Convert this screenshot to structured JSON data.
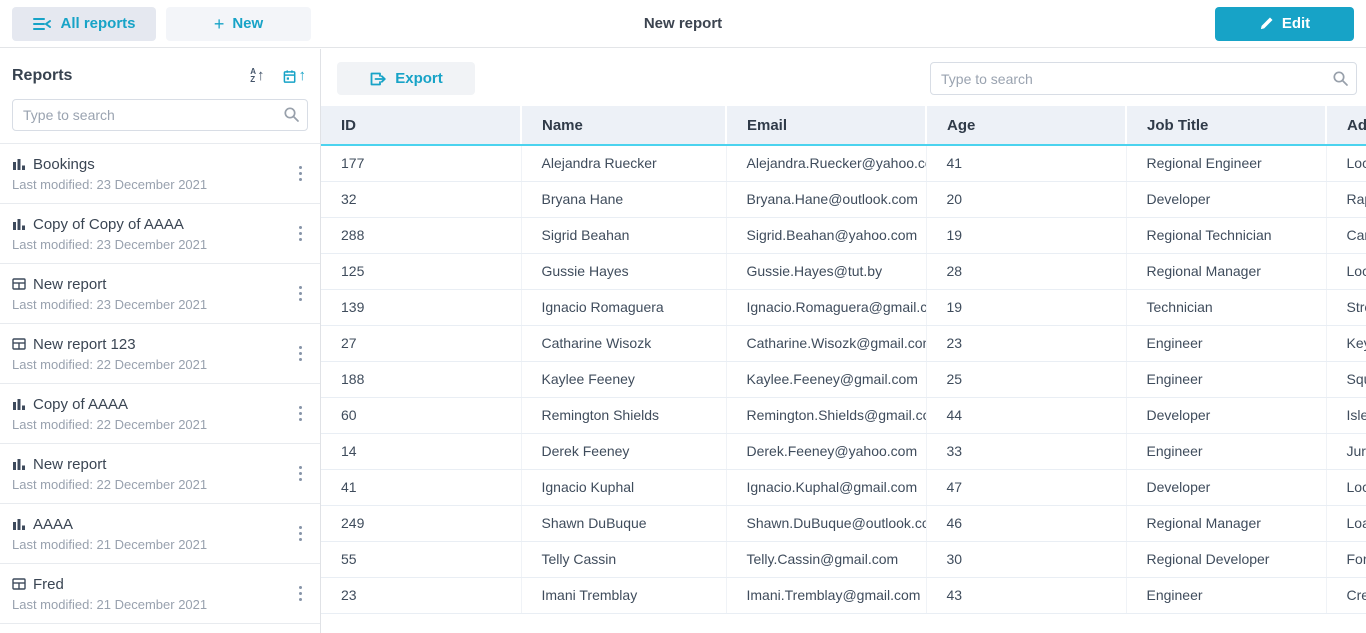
{
  "colors": {
    "accent": "#17a3c7",
    "header_underline": "#4bd3ef"
  },
  "topbar": {
    "all_reports_label": "All reports",
    "new_plus": "+",
    "new_label": "New",
    "title": "New report",
    "edit_label": "Edit"
  },
  "sidebar": {
    "header": "Reports",
    "sort_alpha_top": "A",
    "sort_alpha_bottom": "Z",
    "sort_arrow": "↑",
    "search_placeholder": "Type to search",
    "items": [
      {
        "icon": "bar-chart",
        "title": "Bookings",
        "subtitle": "Last modified: 23 December 2021"
      },
      {
        "icon": "bar-chart",
        "title": "Copy of Copy of AAAA",
        "subtitle": "Last modified: 23 December 2021"
      },
      {
        "icon": "table",
        "title": "New report",
        "subtitle": "Last modified: 23 December 2021"
      },
      {
        "icon": "table",
        "title": "New report 123",
        "subtitle": "Last modified: 22 December 2021"
      },
      {
        "icon": "bar-chart",
        "title": "Copy of AAAA",
        "subtitle": "Last modified: 22 December 2021"
      },
      {
        "icon": "bar-chart",
        "title": "New report",
        "subtitle": "Last modified: 22 December 2021"
      },
      {
        "icon": "bar-chart",
        "title": "AAAA",
        "subtitle": "Last modified: 21 December 2021"
      },
      {
        "icon": "table",
        "title": "Fred",
        "subtitle": "Last modified: 21 December 2021"
      }
    ]
  },
  "main": {
    "export_label": "Export",
    "search_placeholder": "Type to search",
    "table": {
      "columns": [
        "ID",
        "Name",
        "Email",
        "Age",
        "Job Title",
        "Address"
      ],
      "rows": [
        {
          "id": "177",
          "name": "Alejandra Ruecker",
          "email": "Alejandra.Ruecker@yahoo.com",
          "age": "41",
          "job": "Regional Engineer",
          "address": "Loc"
        },
        {
          "id": "32",
          "name": "Bryana Hane",
          "email": "Bryana.Hane@outlook.com",
          "age": "20",
          "job": "Developer",
          "address": "Rap"
        },
        {
          "id": "288",
          "name": "Sigrid Beahan",
          "email": "Sigrid.Beahan@yahoo.com",
          "age": "19",
          "job": "Regional Technician",
          "address": "Car"
        },
        {
          "id": "125",
          "name": "Gussie Hayes",
          "email": "Gussie.Hayes@tut.by",
          "age": "28",
          "job": "Regional Manager",
          "address": "Loc"
        },
        {
          "id": "139",
          "name": "Ignacio Romaguera",
          "email": "Ignacio.Romaguera@gmail.com",
          "age": "19",
          "job": "Technician",
          "address": "Stre"
        },
        {
          "id": "27",
          "name": "Catharine Wisozk",
          "email": "Catharine.Wisozk@gmail.com",
          "age": "23",
          "job": "Engineer",
          "address": "Key"
        },
        {
          "id": "188",
          "name": "Kaylee Feeney",
          "email": "Kaylee.Feeney@gmail.com",
          "age": "25",
          "job": "Engineer",
          "address": "Squ"
        },
        {
          "id": "60",
          "name": "Remington Shields",
          "email": "Remington.Shields@gmail.com",
          "age": "44",
          "job": "Developer",
          "address": "Isle"
        },
        {
          "id": "14",
          "name": "Derek Feeney",
          "email": "Derek.Feeney@yahoo.com",
          "age": "33",
          "job": "Engineer",
          "address": "Jur"
        },
        {
          "id": "41",
          "name": "Ignacio Kuphal",
          "email": "Ignacio.Kuphal@gmail.com",
          "age": "47",
          "job": "Developer",
          "address": "Loc"
        },
        {
          "id": "249",
          "name": "Shawn DuBuque",
          "email": "Shawn.DuBuque@outlook.com",
          "age": "46",
          "job": "Regional Manager",
          "address": "Loa"
        },
        {
          "id": "55",
          "name": "Telly Cassin",
          "email": "Telly.Cassin@gmail.com",
          "age": "30",
          "job": "Regional Developer",
          "address": "For"
        },
        {
          "id": "23",
          "name": "Imani Tremblay",
          "email": "Imani.Tremblay@gmail.com",
          "age": "43",
          "job": "Engineer",
          "address": "Cre"
        }
      ]
    }
  }
}
